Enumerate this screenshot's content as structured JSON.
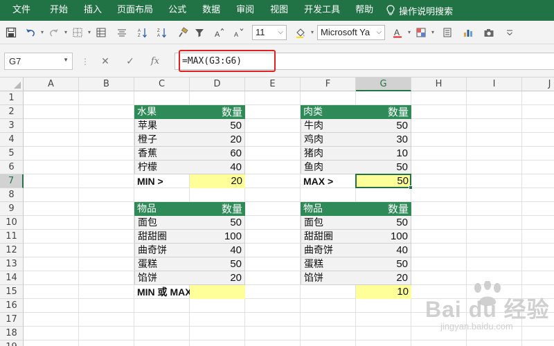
{
  "ribbon": {
    "tabs": [
      "文件",
      "开始",
      "插入",
      "页面布局",
      "公式",
      "数据",
      "审阅",
      "视图",
      "开发工具",
      "帮助"
    ],
    "tell_me": "操作说明搜索"
  },
  "toolbar": {
    "font_size": "11",
    "font_name": "Microsoft Ya",
    "icons": [
      "save-icon",
      "undo-icon",
      "redo-icon",
      "borders-icon",
      "freeze-icon",
      "align-icon",
      "sort-asc-icon",
      "sort-desc-icon",
      "format-painter-icon",
      "filter-icon",
      "increase-font-icon",
      "decrease-font-icon",
      "fill-color-icon",
      "font-color-icon",
      "conditional-format-icon",
      "form-icon",
      "chart-icon",
      "camera-icon",
      "customize-icon"
    ]
  },
  "formula_bar": {
    "name_box": "G7",
    "formula": "=MAX(G3:G6)",
    "fx_label": "fx"
  },
  "grid": {
    "columns": [
      "A",
      "B",
      "C",
      "D",
      "E",
      "F",
      "G",
      "H",
      "I",
      "J"
    ],
    "rows": [
      "1",
      "2",
      "3",
      "4",
      "5",
      "6",
      "7",
      "8",
      "9",
      "10",
      "11",
      "12",
      "13",
      "14",
      "15",
      "16",
      "17",
      "18",
      "19"
    ],
    "selected_column": "G",
    "selected_row": "7"
  },
  "tables": {
    "fruit": {
      "header": [
        "水果",
        "数量"
      ],
      "rows": [
        [
          "苹果",
          "50"
        ],
        [
          "橙子",
          "20"
        ],
        [
          "香蕉",
          "60"
        ],
        [
          "柠檬",
          "40"
        ]
      ],
      "summary_label": "MIN >",
      "summary_value": "20"
    },
    "meat": {
      "header": [
        "肉类",
        "数量"
      ],
      "rows": [
        [
          "牛肉",
          "50"
        ],
        [
          "鸡肉",
          "30"
        ],
        [
          "猪肉",
          "10"
        ],
        [
          "鱼肉",
          "50"
        ]
      ],
      "summary_label": "MAX >",
      "summary_value": "50"
    },
    "items1": {
      "header": [
        "物品",
        "数量"
      ],
      "rows": [
        [
          "面包",
          "50"
        ],
        [
          "甜甜圈",
          "100"
        ],
        [
          "曲奇饼",
          "40"
        ],
        [
          "蛋糕",
          "50"
        ],
        [
          "馅饼",
          "20"
        ]
      ],
      "summary_label": "MIN 或 MAX >"
    },
    "items2": {
      "header": [
        "物品",
        "数量"
      ],
      "rows": [
        [
          "面包",
          "50"
        ],
        [
          "甜甜圈",
          "100"
        ],
        [
          "曲奇饼",
          "40"
        ],
        [
          "蛋糕",
          "50"
        ],
        [
          "馅饼",
          "20"
        ]
      ],
      "summary_value": "10"
    }
  },
  "watermark": {
    "main": "Bai du 经验",
    "sub": "jingyan.baidu.com"
  }
}
